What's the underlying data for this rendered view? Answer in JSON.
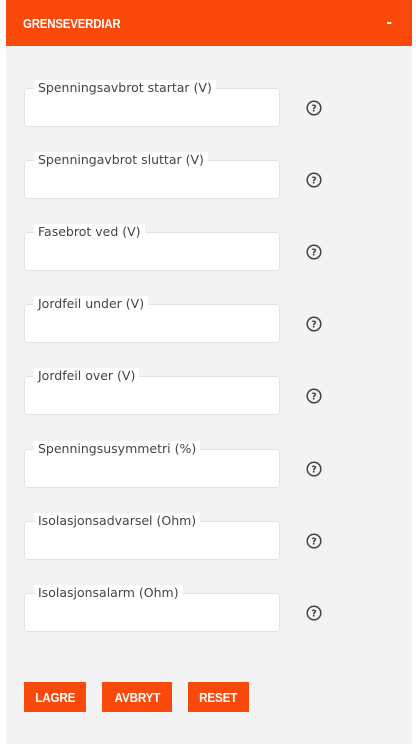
{
  "panel": {
    "title": "GRENSEVERDIAR",
    "collapse_symbol": "-"
  },
  "fields": [
    {
      "label": "Spenningsavbrot startar (V)",
      "value": "",
      "icon": "help-circle-icon"
    },
    {
      "label": "Spenningavbrot sluttar (V)",
      "value": "",
      "icon": "help-circle-icon"
    },
    {
      "label": "Fasebrot ved (V)",
      "value": "",
      "icon": "help-circle-icon"
    },
    {
      "label": "Jordfeil under (V)",
      "value": "",
      "icon": "help-circle-icon"
    },
    {
      "label": "Jordfeil over (V)",
      "value": "",
      "icon": "help-circle-icon"
    },
    {
      "label": "Spenningsusymmetri (%)",
      "value": "",
      "icon": "help-circle-icon"
    },
    {
      "label": "Isolasjonsadvarsel (Ohm)",
      "value": "",
      "icon": "help-circle-icon"
    },
    {
      "label": "Isolasjonsalarm (Ohm)",
      "value": "",
      "icon": "help-circle-icon"
    }
  ],
  "buttons": {
    "save": "LAGRE",
    "cancel": "AVBRYT",
    "reset": "RESET"
  },
  "colors": {
    "accent": "#f94a0b",
    "panel_bg": "#f3f3f3",
    "label_text": "#444444"
  }
}
